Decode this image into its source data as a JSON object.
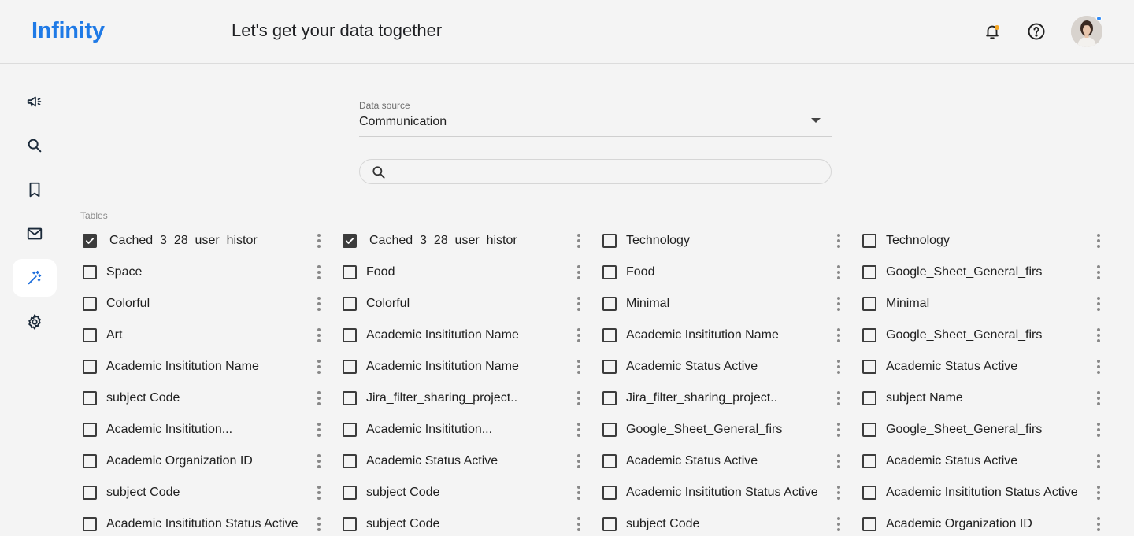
{
  "header": {
    "logo": "Infinity",
    "title": "Let's get your data together",
    "icons": [
      "bell-icon",
      "help-icon"
    ],
    "notification_dot_color": "#f5a623",
    "presence_dot_color": "#2f8af5"
  },
  "sidebar": {
    "items": [
      {
        "icon": "megaphone-icon"
      },
      {
        "icon": "search-icon"
      },
      {
        "icon": "bookmark-icon"
      },
      {
        "icon": "mail-icon"
      },
      {
        "icon": "magic-wand-icon",
        "active": true
      },
      {
        "icon": "gear-icon"
      }
    ]
  },
  "data_source": {
    "label": "Data source",
    "value": "Communication"
  },
  "search": {
    "placeholder": "",
    "value": ""
  },
  "tables": {
    "label": "Tables",
    "columns": [
      {
        "items": [
          {
            "label": "Cached_3_28_user_histor",
            "checked": true
          },
          {
            "label": "Space",
            "checked": false
          },
          {
            "label": "Colorful",
            "checked": false
          },
          {
            "label": "Art",
            "checked": false
          },
          {
            "label": "Academic Insititution Name",
            "checked": false
          },
          {
            "label": "subject Code",
            "checked": false
          },
          {
            "label": "Academic Insititution...",
            "checked": false
          },
          {
            "label": "Academic Organization ID",
            "checked": false
          },
          {
            "label": "subject Code",
            "checked": false
          },
          {
            "label": "Academic Insititution Status Active",
            "checked": false
          }
        ]
      },
      {
        "items": [
          {
            "label": "Cached_3_28_user_histor",
            "checked": true
          },
          {
            "label": "Food",
            "checked": false
          },
          {
            "label": "Colorful",
            "checked": false
          },
          {
            "label": "Academic Insititution Name",
            "checked": false
          },
          {
            "label": "Academic Insititution Name",
            "checked": false
          },
          {
            "label": "Jira_filter_sharing_project..",
            "checked": false
          },
          {
            "label": "Academic Insititution...",
            "checked": false
          },
          {
            "label": "Academic Status Active",
            "checked": false
          },
          {
            "label": "subject Code",
            "checked": false
          },
          {
            "label": "subject Code",
            "checked": false
          }
        ]
      },
      {
        "items": [
          {
            "label": "Technology",
            "checked": false
          },
          {
            "label": "Food",
            "checked": false
          },
          {
            "label": "Minimal",
            "checked": false
          },
          {
            "label": "Academic Insititution Name",
            "checked": false
          },
          {
            "label": "Academic Status Active",
            "checked": false
          },
          {
            "label": "Jira_filter_sharing_project..",
            "checked": false
          },
          {
            "label": "Google_Sheet_General_firs",
            "checked": false
          },
          {
            "label": "Academic Status Active",
            "checked": false
          },
          {
            "label": "Academic Insititution Status Active",
            "checked": false
          },
          {
            "label": "subject Code",
            "checked": false
          }
        ]
      },
      {
        "items": [
          {
            "label": "Technology",
            "checked": false
          },
          {
            "label": "Google_Sheet_General_firs",
            "checked": false
          },
          {
            "label": "Minimal",
            "checked": false
          },
          {
            "label": "Google_Sheet_General_firs",
            "checked": false
          },
          {
            "label": "Academic Status Active",
            "checked": false
          },
          {
            "label": "subject Name",
            "checked": false
          },
          {
            "label": "Google_Sheet_General_firs",
            "checked": false
          },
          {
            "label": "Academic Status Active",
            "checked": false
          },
          {
            "label": "Academic Insititution Status Active",
            "checked": false
          },
          {
            "label": "Academic Organization ID",
            "checked": false
          }
        ]
      }
    ]
  }
}
